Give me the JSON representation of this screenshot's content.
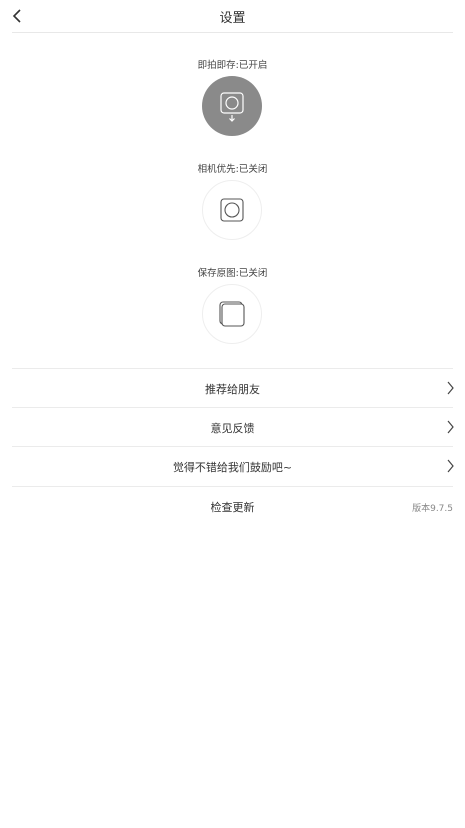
{
  "header": {
    "title": "设置"
  },
  "toggles": [
    {
      "label": "即拍即存:已开启",
      "state": "on",
      "icon": "camera-save-icon"
    },
    {
      "label": "相机优先:已关闭",
      "state": "off",
      "icon": "camera-icon"
    },
    {
      "label": "保存原图:已关闭",
      "state": "off",
      "icon": "stacked-photos-icon"
    }
  ],
  "menu": {
    "recommend": "推荐给朋友",
    "feedback": "意见反馈",
    "rate": "觉得不错给我们鼓励吧~",
    "check_update": "检查更新",
    "version": "版本9.7.5"
  },
  "colors": {
    "toggle_on": "#8a8a8a",
    "divider": "#ebebeb"
  }
}
